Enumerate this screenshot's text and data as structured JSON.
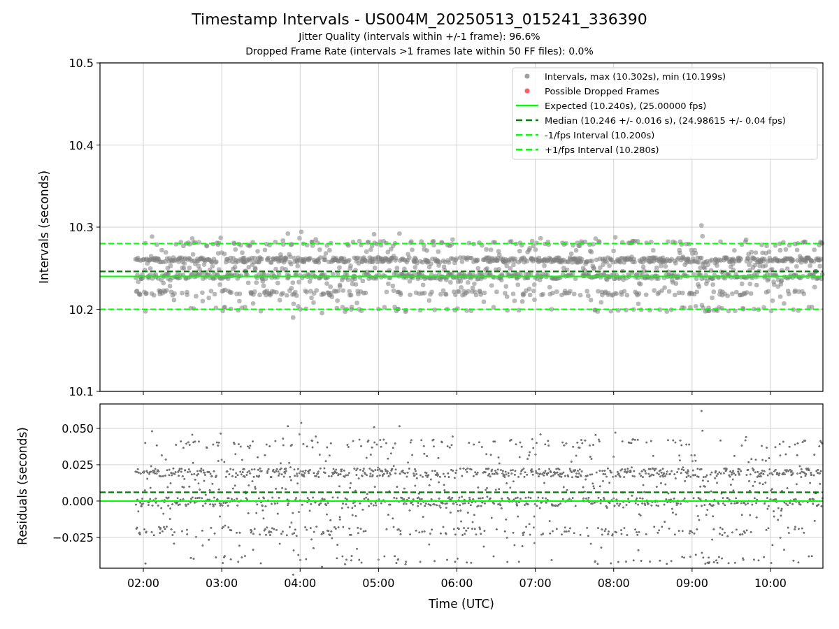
{
  "figure": {
    "title": "Timestamp Intervals - US004M_20250513_015241_336390",
    "subtitles": [
      "Jitter Quality (intervals within +/-1 frame): 96.6%",
      "Dropped Frame Rate (intervals >1 frames late within 50 FF files): 0.0%"
    ]
  },
  "charts": [
    {
      "chart_data": {
        "type": "scatter",
        "ylabel": "Intervals (seconds)",
        "grid": true,
        "xlim": [
          1.447,
          10.669
        ],
        "ylim": [
          10.1,
          10.5
        ],
        "yticks": [
          {
            "value": 10.1,
            "label": "10.1"
          },
          {
            "value": 10.2,
            "label": "10.2"
          },
          {
            "value": 10.3,
            "label": "10.3"
          },
          {
            "value": 10.4,
            "label": "10.4"
          },
          {
            "value": 10.5,
            "label": "10.5"
          }
        ],
        "ref_lines": [
          {
            "axis": "y",
            "value": 10.24,
            "label": "Expected (10.240s), (25.00000 fps)",
            "color": "#00ff00",
            "line_style": "solid"
          },
          {
            "axis": "y",
            "value": 10.246,
            "label": "Median (10.246 +/- 0.016 s), (24.98615 +/- 0.04 fps)",
            "color": "#008000",
            "line_style": "dashed"
          },
          {
            "axis": "y",
            "value": 10.2,
            "label": "-1/fps Interval (10.200s)",
            "color": "#00ff00",
            "line_style": "dashed"
          },
          {
            "axis": "y",
            "value": 10.28,
            "label": "+1/fps Interval (10.280s)",
            "color": "#00ff00",
            "line_style": "dashed"
          }
        ],
        "legend": true
      },
      "legend": [
        {
          "color": "#a0a0a0",
          "label": "Intervals, max (10.302s), min (10.199s)"
        },
        {
          "color": "#ff6060",
          "label": "Possible Dropped Frames"
        }
      ]
    },
    {
      "chart_data": {
        "type": "scatter",
        "xlabel": "Time (UTC)",
        "ylabel": "Residuals (seconds)",
        "grid": true,
        "xlim": [
          1.447,
          10.669
        ],
        "ylim": [
          -0.0462,
          0.0668
        ],
        "xticks": [
          {
            "value": 2,
            "label": "02:00"
          },
          {
            "value": 3,
            "label": "03:00"
          },
          {
            "value": 4,
            "label": "04:00"
          },
          {
            "value": 5,
            "label": "05:00"
          },
          {
            "value": 6,
            "label": "06:00"
          },
          {
            "value": 7,
            "label": "07:00"
          },
          {
            "value": 8,
            "label": "08:00"
          },
          {
            "value": 9,
            "label": "09:00"
          },
          {
            "value": 10,
            "label": "10:00"
          }
        ],
        "yticks": [
          {
            "value": -0.025,
            "label": "−0.025"
          },
          {
            "value": 0,
            "label": "0.000"
          },
          {
            "value": 0.025,
            "label": "0.025"
          },
          {
            "value": 0.05,
            "label": "0.050"
          }
        ],
        "ref_lines": [
          {
            "axis": "y",
            "value": 0,
            "color": "#00ff00",
            "line_style": "solid"
          },
          {
            "axis": "y",
            "value": 0.006,
            "color": "#008000",
            "line_style": "dashed"
          }
        ]
      }
    }
  ]
}
